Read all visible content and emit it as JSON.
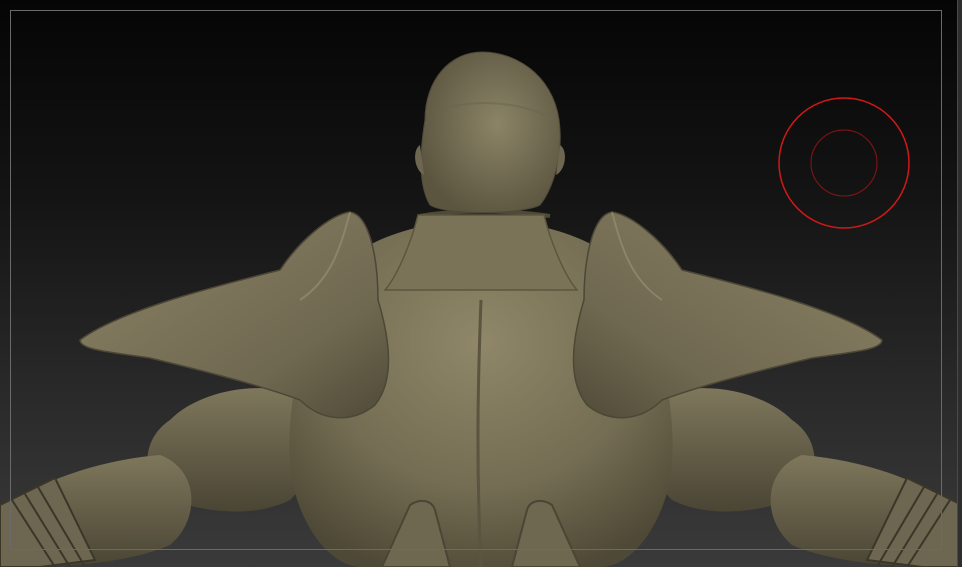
{
  "viewport": {
    "background_top": "#050505",
    "background_bottom": "#3a3a3a",
    "frame_color": "#6a6a6a"
  },
  "model": {
    "material_color": "#7d765c",
    "icon": "sculpt-mesh-icon"
  },
  "brush_cursor": {
    "outer_color": "#d01818",
    "inner_color": "#8a1414",
    "icon": "brush-draw-size-icon"
  }
}
